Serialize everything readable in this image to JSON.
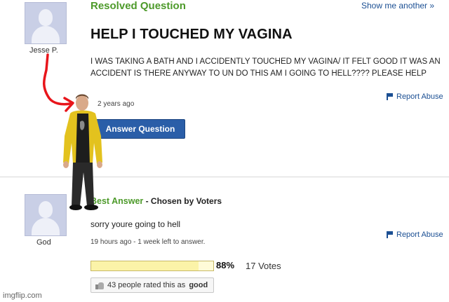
{
  "question": {
    "status": "Resolved Question",
    "show_more": "Show me another »",
    "asker": "Jesse P.",
    "title": "HELP I TOUCHED MY VAGINA",
    "body": "I WAS TAKING A BATH AND I ACCIDENTLY TOUCHED MY VAGINA/ IT FELT GOOD IT WAS AN ACCIDENT IS THERE ANYWAY TO UN DO THIS AM I GOING TO HELL???? PLEASE HELP",
    "age": "2 years ago",
    "report_label": "Report Abuse",
    "answer_button": "Answer Question"
  },
  "best_answer": {
    "heading": "Best Answer",
    "chosen_by": " - Chosen by Voters",
    "answerer": "God",
    "text": "sorry youre going to hell",
    "meta": "19 hours ago - 1 week left to answer.",
    "report_label": "Report Abuse",
    "vote_percent": "88%",
    "vote_fraction": 0.88,
    "votes": "17 Votes",
    "rating_count": "43 people rated this as",
    "rating_word": "good"
  },
  "watermark": "imgflip.com",
  "colors": {
    "resolved_green": "#4d9a2a",
    "link_blue": "#1b4f93",
    "button_blue": "#2a5ea8",
    "arrow_red": "#e8151b"
  }
}
